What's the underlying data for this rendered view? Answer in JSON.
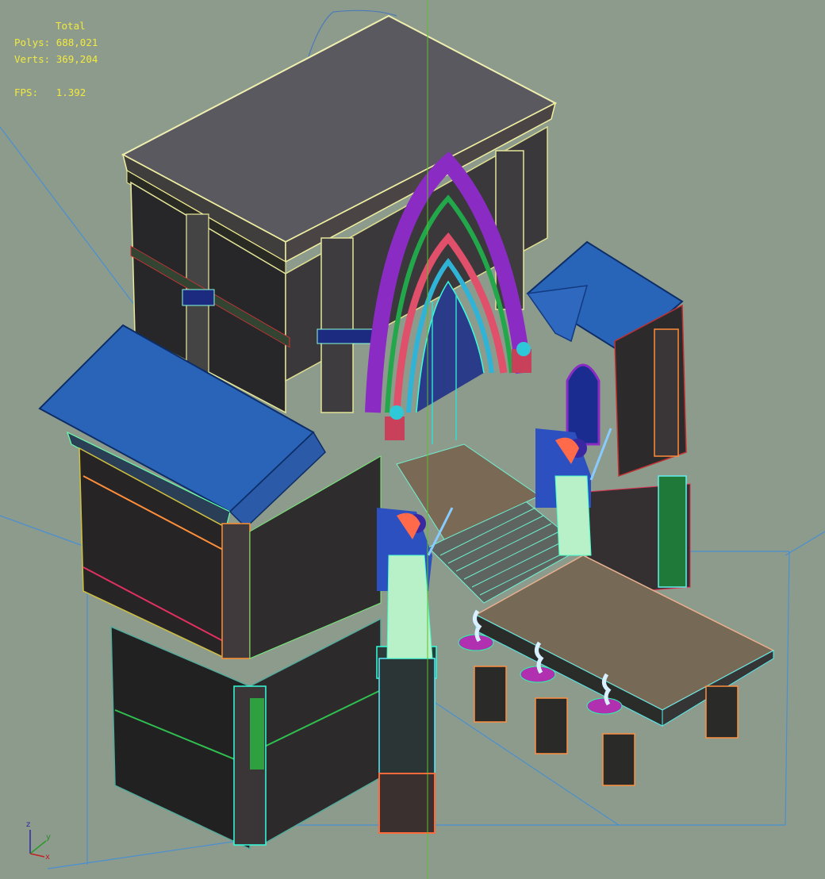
{
  "stats": {
    "title": "Total",
    "polys_label": "Polys:",
    "polys_value": "688,021",
    "verts_label": "Verts:",
    "verts_value": "369,204",
    "fps_label": "FPS:",
    "fps_value": "1.392"
  },
  "axis_gizmo": {
    "z": "z",
    "y": "y",
    "x": "x"
  },
  "colors": {
    "background": "#8d9b8d",
    "stats_text": "#f2ea3e",
    "grid_line": "#4a90d0",
    "vertical_axis": "#5fbf2a"
  }
}
